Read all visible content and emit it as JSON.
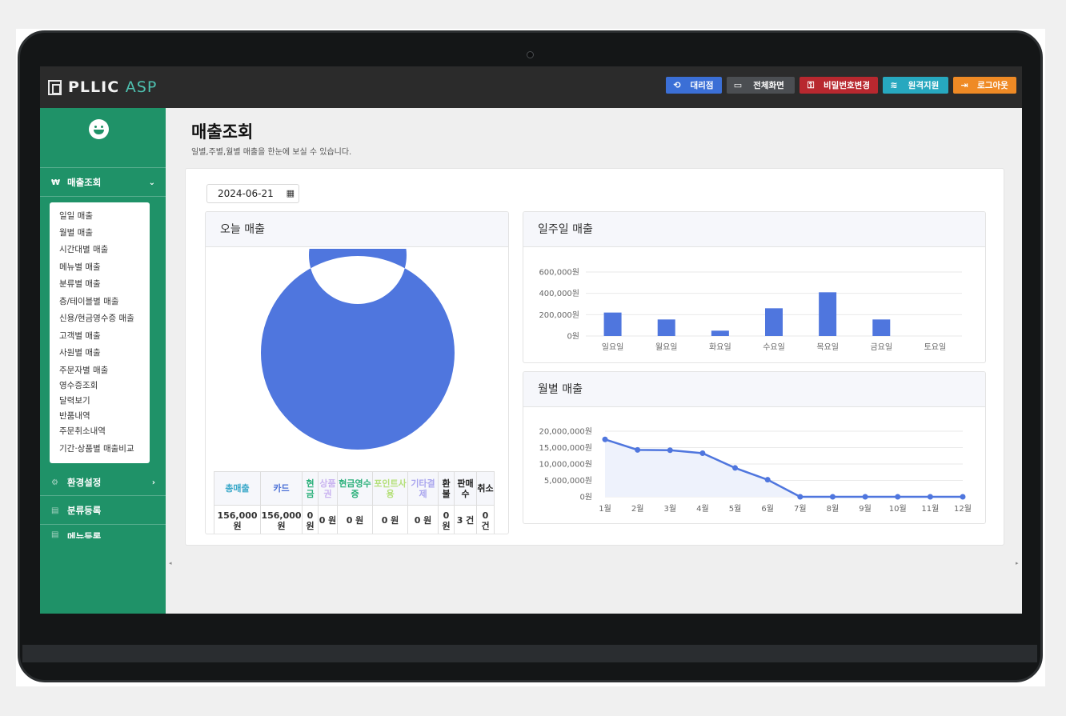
{
  "app": {
    "logo_main": "PLLIC",
    "logo_accent": "ASP"
  },
  "top_buttons": [
    {
      "label": "대리점",
      "icon": "undo-icon",
      "glyph": "⟲",
      "color": "#3b6fd6"
    },
    {
      "label": "전체화면",
      "icon": "monitor-icon",
      "glyph": "▭",
      "color": "#4b4e52"
    },
    {
      "label": "비밀번호변경",
      "icon": "key-icon",
      "glyph": "⚿",
      "color": "#b8282f"
    },
    {
      "label": "원격지원",
      "icon": "wifi-icon",
      "glyph": "≋",
      "color": "#27a8bf"
    },
    {
      "label": "로그아웃",
      "icon": "logout-icon",
      "glyph": "⇥",
      "color": "#ef8a25"
    }
  ],
  "sidebar": {
    "sales_menu": {
      "label": "매출조회",
      "icon": "won-icon",
      "glyph": "₩"
    },
    "sub_items": [
      "일일 매출",
      "월별 매출",
      "시간대별 매출",
      "메뉴별 매출",
      "분류별 매출",
      "층/테이블별 매출",
      "신용/현금영수증 매출",
      "고객별 매출",
      "사원별 매출",
      "주문자별 매출",
      "영수증조회",
      "달력보기",
      "반품내역",
      "주문취소내역",
      "기간·상품별 매출비교"
    ],
    "settings_menu": {
      "label": "환경설정",
      "icon": "gear-icon",
      "glyph": "⚙"
    },
    "category_menu": {
      "label": "분류등록",
      "icon": "grid-icon",
      "glyph": "▤"
    },
    "menu_reg": {
      "label": "메뉴등록",
      "icon": "list-icon",
      "glyph": "▤"
    }
  },
  "page": {
    "title": "매출조회",
    "subtitle": "일별,주별,월별 매출을 한눈에 보실 수 있습니다.",
    "date_value": "2024-06-21"
  },
  "today_panel": {
    "title": "오늘 매출",
    "table": {
      "headers": [
        {
          "text": "총매출",
          "color": "#3aa8c9"
        },
        {
          "text": "카드",
          "color": "#4a6fd6"
        },
        {
          "text": "현금",
          "color": "#2bb07a"
        },
        {
          "text": "상품권",
          "color": "#c9b3f0"
        },
        {
          "text": "현금영수증",
          "color": "#2bb07a"
        },
        {
          "text": "포인트사용",
          "color": "#b5e07a"
        },
        {
          "text": "기타결제",
          "color": "#a9a5ee"
        },
        {
          "text": "환불",
          "color": "#222222"
        },
        {
          "text": "판매수",
          "color": "#222222"
        },
        {
          "text": "취소",
          "color": "#222222"
        }
      ],
      "values": [
        "156,000 원",
        "156,000 원",
        "0 원",
        "0 원",
        "0 원",
        "0 원",
        "0 원",
        "0 원",
        "3 건",
        "0 건"
      ]
    }
  },
  "week_panel": {
    "title": "일주일 매출"
  },
  "month_panel": {
    "title": "월별 매출"
  },
  "chart_data": [
    {
      "type": "pie",
      "variant": "donut",
      "labels": [
        "카드",
        "현금"
      ],
      "values": [
        156000,
        0
      ],
      "colors": [
        "#4f76de",
        "#2bb07a"
      ]
    },
    {
      "type": "bar",
      "categories": [
        "일요일",
        "월요일",
        "화요일",
        "수요일",
        "목요일",
        "금요일",
        "토요일"
      ],
      "values": [
        220000,
        155000,
        50000,
        260000,
        410000,
        155000,
        0
      ],
      "ylim": [
        0,
        600000
      ],
      "yticks": [
        "600,000원",
        "400,000원",
        "200,000원",
        "0원"
      ],
      "grid": true,
      "color": "#4f76de"
    },
    {
      "type": "line",
      "categories": [
        "1월",
        "2월",
        "3월",
        "4월",
        "5월",
        "6월",
        "7월",
        "8월",
        "9월",
        "10월",
        "11월",
        "12월"
      ],
      "values": [
        17500000,
        14300000,
        14200000,
        13300000,
        8800000,
        5200000,
        0,
        0,
        0,
        0,
        0,
        0
      ],
      "ylim": [
        0,
        20000000
      ],
      "yticks": [
        "20,000,000원",
        "15,000,000원",
        "10,000,000원",
        "5,000,000원",
        "0원"
      ],
      "grid": true,
      "color": "#4f76de",
      "fill": "#eef2fc"
    }
  ]
}
